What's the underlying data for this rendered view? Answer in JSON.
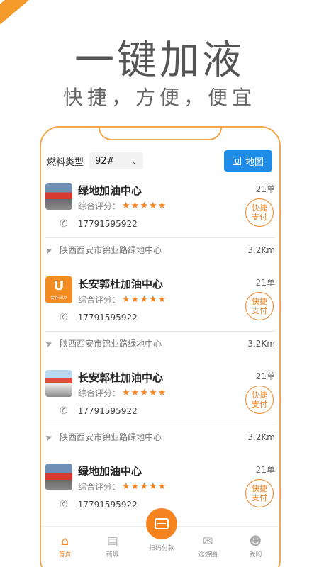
{
  "hero": {
    "title": "一键加液",
    "subtitle": "快捷，方便，便宜"
  },
  "filter": {
    "label": "燃料类型",
    "fuel_value": "92#",
    "map_label": "地图"
  },
  "stations": [
    {
      "name": "绿地加油中心",
      "thumb": "photo",
      "rating_label": "综合评分：",
      "stars": "★★★★★",
      "rating": 5,
      "phone": "17791595922",
      "orders": "21单",
      "pay_label": "快捷 支付",
      "address": "陕西西安市锦业路绿地中心",
      "distance": "3.2Km"
    },
    {
      "name": "长安郭杜加油中心",
      "thumb": "logo",
      "logo_text": "合作站点",
      "rating_label": "综合评分：",
      "stars": "★★★★★",
      "rating": 5,
      "phone": "17791595922",
      "orders": "21单",
      "pay_label": "快捷 支付",
      "address": "陕西西安市锦业路绿地中心",
      "distance": "3.2Km"
    },
    {
      "name": "长安郭杜加油中心",
      "thumb": "photo-alt",
      "rating_label": "综合评分：",
      "stars": "★★★★★",
      "rating": 5,
      "phone": "17791595922",
      "orders": "21单",
      "pay_label": "快捷 支付",
      "address": "陕西西安市锦业路绿地中心",
      "distance": "3.2Km"
    },
    {
      "name": "绿地加油中心",
      "thumb": "photo",
      "rating_label": "综合评分：",
      "stars": "★★★★★",
      "rating": 5,
      "phone": "17791595922",
      "orders": "21单",
      "pay_label": "快捷 支付"
    }
  ],
  "tabs": [
    {
      "label": "首页",
      "icon": "home-icon",
      "active": true
    },
    {
      "label": "商城",
      "icon": "store-icon",
      "active": false
    },
    {
      "label": "扫码付款",
      "icon": "scan-icon",
      "active": false
    },
    {
      "label": "途游圈",
      "icon": "chat-icon",
      "active": false
    },
    {
      "label": "我的",
      "icon": "user-icon",
      "active": false
    }
  ],
  "colors": {
    "accent": "#f5831f",
    "map_button": "#1f8de8",
    "frame": "#f6a64a"
  }
}
